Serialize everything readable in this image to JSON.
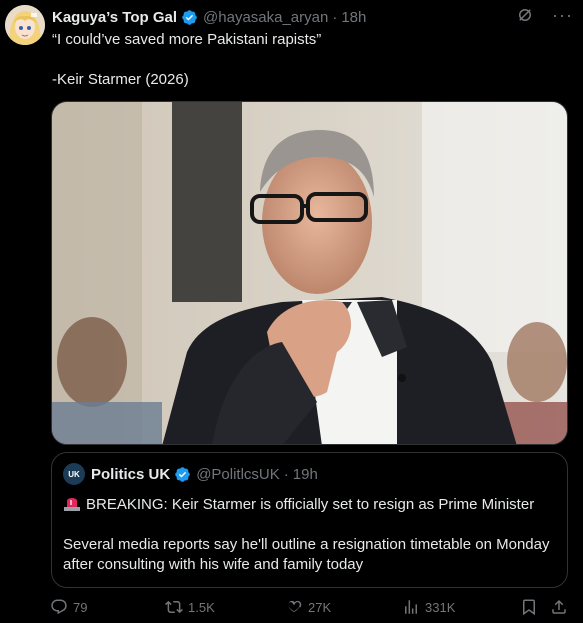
{
  "tweet": {
    "display_name": "Kaguya’s Top Gal",
    "handle": "@hayasaka_aryan",
    "separator": "·",
    "time": "18h",
    "text_line1": "“I could’ve saved more Pakistani rapists”",
    "text_line2": "-Keir Starmer (2026)"
  },
  "quote": {
    "display_name": "Politics UK",
    "handle": "@PolitlcsUK",
    "separator": "·",
    "time": "19h",
    "avatar_text": "UK",
    "line1": "BREAKING: Keir Starmer is officially set to resign as Prime Minister",
    "line2": "Several media reports say he'll outline a resignation timetable on Monday after consulting with his wife and family today"
  },
  "actions": {
    "replies": "79",
    "reposts": "1.5K",
    "likes": "27K",
    "views": "331K"
  },
  "icons": [
    "grok-icon",
    "more-icon",
    "verified-badge-icon",
    "siren-icon",
    "reply-icon",
    "repost-icon",
    "like-icon",
    "views-icon",
    "bookmark-icon",
    "share-icon"
  ],
  "colors": {
    "background": "#000000",
    "text": "#e7e9ea",
    "secondary": "#71767b",
    "verified": "#1d9bf0",
    "border": "#2f3336"
  }
}
